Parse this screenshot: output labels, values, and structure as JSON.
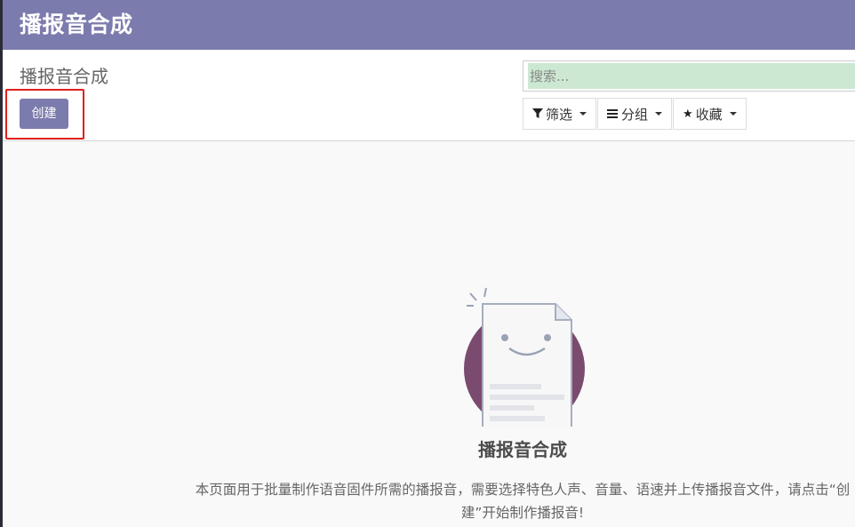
{
  "navbar": {
    "title": "播报音合成"
  },
  "control_panel": {
    "breadcrumb": "播报音合成",
    "create_label": "创建",
    "search": {
      "placeholder": "搜索..."
    },
    "filters": [
      {
        "label": "筛选",
        "icon": "funnel-icon"
      },
      {
        "label": "分组",
        "icon": "bars-icon"
      },
      {
        "label": "收藏",
        "icon": "star-icon"
      }
    ]
  },
  "empty_state": {
    "title": "播报音合成",
    "description": "本页面用于批量制作语音固件所需的播报音，需要选择特色人声、音量、语速并上传播报音文件，请点击“创建”开始制作播报音!"
  },
  "colors": {
    "brand": "#7c7bad",
    "highlight": "#e0201c",
    "circle": "#7a4b6e",
    "search_bg": "#cde8d2"
  }
}
